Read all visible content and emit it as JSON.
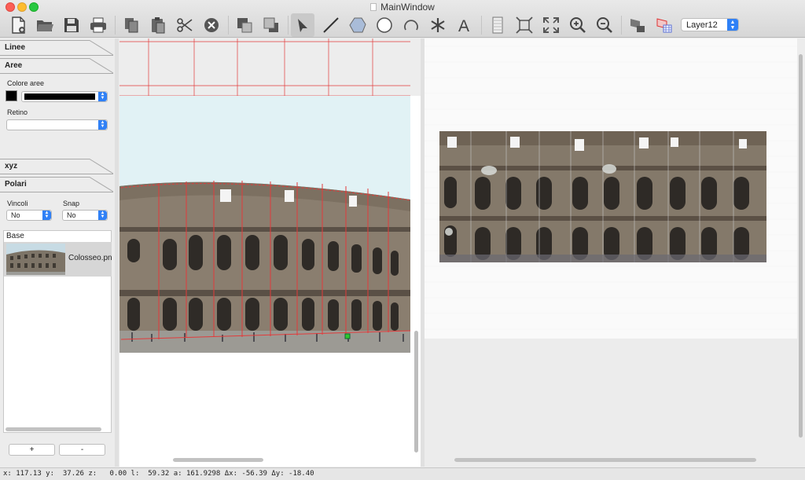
{
  "window": {
    "title": "MainWindow"
  },
  "toolbar": {
    "buttons": [
      {
        "name": "new-file-icon"
      },
      {
        "name": "open-folder-icon"
      },
      {
        "name": "save-icon"
      },
      {
        "name": "print-icon"
      },
      {
        "name": "copy-icon"
      },
      {
        "name": "paste-icon"
      },
      {
        "name": "cut-icon"
      },
      {
        "name": "delete-icon"
      },
      {
        "name": "bring-front-icon"
      },
      {
        "name": "send-back-icon"
      },
      {
        "name": "select-arrow-icon"
      },
      {
        "name": "line-tool-icon"
      },
      {
        "name": "polygon-tool-icon"
      },
      {
        "name": "circle-tool-icon"
      },
      {
        "name": "arc-tool-icon"
      },
      {
        "name": "star-tool-icon"
      },
      {
        "name": "text-tool-icon"
      },
      {
        "name": "grid-icon"
      },
      {
        "name": "fit-selection-icon"
      },
      {
        "name": "fit-all-icon"
      },
      {
        "name": "zoom-in-icon"
      },
      {
        "name": "zoom-out-icon"
      },
      {
        "name": "layer-image-icon"
      },
      {
        "name": "layer-grid-icon"
      }
    ],
    "layer_select": "Layer12"
  },
  "dock": {
    "tab_linee": "Linee",
    "tab_aree": "Aree",
    "colore_aree_label": "Colore aree",
    "retino_label": "Retino",
    "tab_xyz": "xyz",
    "tab_polari": "Polari",
    "vincoli_label": "Vincoli",
    "vincoli_value": "No",
    "snap_label": "Snap",
    "snap_value": "No",
    "list_header": "Base",
    "list_items": [
      {
        "label": "Colosseo.png"
      }
    ],
    "add_label": "+",
    "remove_label": "-"
  },
  "colors": {
    "accent": "#2f80f6",
    "grid_line": "#e23b3b",
    "sky": "#e1f2f5"
  },
  "status": {
    "text": "x: 117.13 y:  37.26 z:   0.00 l:  59.32 a: 161.9298 Δx: -56.39 Δy: -18.40"
  }
}
